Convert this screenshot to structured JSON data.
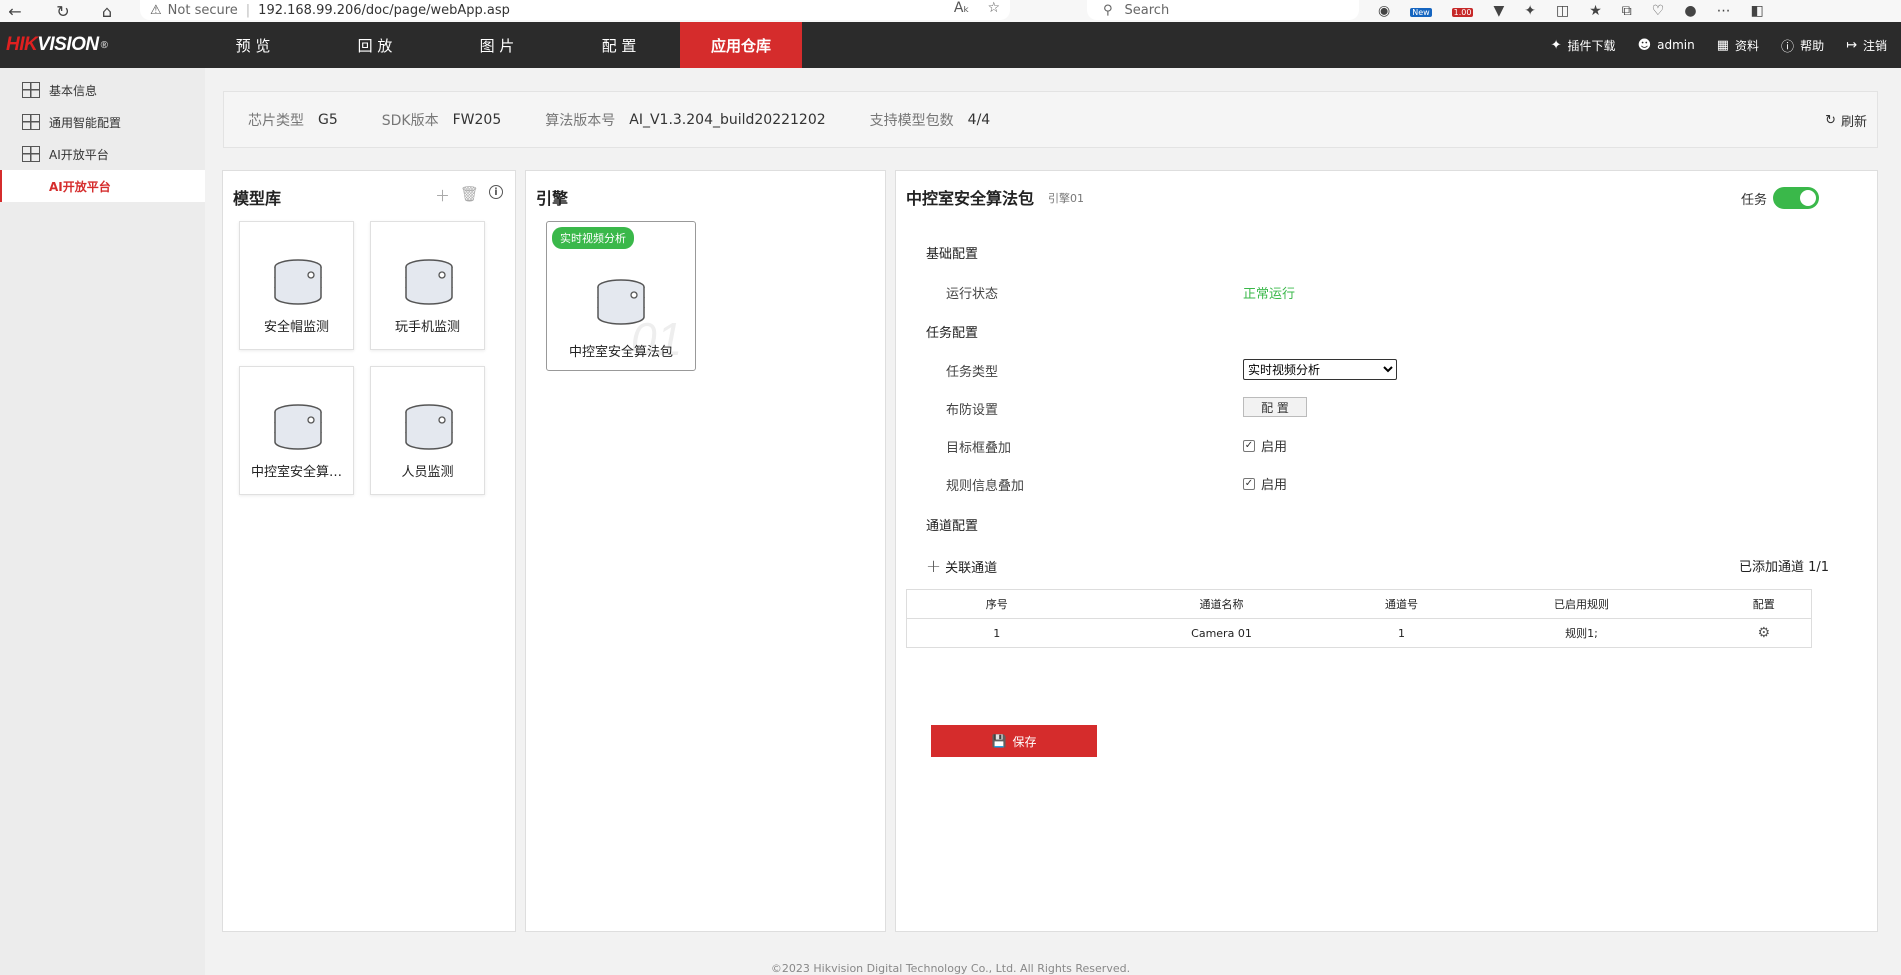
{
  "browser": {
    "security_label": "Not secure",
    "url": "192.168.99.206/doc/page/webApp.asp",
    "search_placeholder": "Search",
    "ext_badge_new": "New",
    "ext_badge_version": "1.00"
  },
  "header": {
    "logo_brand": "HIK",
    "logo_rest": "VISION",
    "logo_reg": "®",
    "menu": [
      {
        "label": "预 览"
      },
      {
        "label": "回 放"
      },
      {
        "label": "图 片"
      },
      {
        "label": "配 置"
      },
      {
        "label": "应用仓库"
      }
    ],
    "active_index": 4,
    "plugin_download": "插件下载",
    "user": "admin",
    "docs": "资料",
    "help": "帮助",
    "logout": "注销"
  },
  "sidebar": {
    "items": [
      {
        "label": "基本信息"
      },
      {
        "label": "通用智能配置"
      },
      {
        "label": "AI开放平台"
      }
    ],
    "active_label": "AI开放平台"
  },
  "info": {
    "chip_label": "芯片类型",
    "chip_value": "G5",
    "sdk_label": "SDK版本",
    "sdk_value": "FW205",
    "algo_label": "算法版本号",
    "algo_value": "AI_V1.3.204_build20221202",
    "model_label": "支持模型包数",
    "model_value": "4/4",
    "refresh": "刷新"
  },
  "model_lib": {
    "title": "模型库",
    "items": [
      {
        "name": "安全帽监测"
      },
      {
        "name": "玩手机监测"
      },
      {
        "name": "中控室安全算…"
      },
      {
        "name": "人员监测"
      }
    ]
  },
  "engine": {
    "title": "引擎",
    "card_tag": "实时视频分析",
    "card_watermark": "01",
    "card_name": "中控室安全算法包"
  },
  "detail": {
    "title": "中控室安全算法包",
    "subtitle": "引擎01",
    "task_label": "任务",
    "task_enabled": true,
    "basic_section": "基础配置",
    "run_status_label": "运行状态",
    "run_status_value": "正常运行",
    "task_section": "任务配置",
    "task_type_label": "任务类型",
    "task_type_value": "实时视频分析",
    "defense_label": "布防设置",
    "defense_button": "配 置",
    "target_box_label": "目标框叠加",
    "target_box_enabled": "启用",
    "rule_info_label": "规则信息叠加",
    "rule_info_enabled": "启用",
    "channel_section": "通道配置",
    "assoc_channel": "关联通道",
    "added_channels": "已添加通道 1/1",
    "table": {
      "headers": [
        "序号",
        "通道名称",
        "通道号",
        "已启用规则",
        "配置"
      ],
      "rows": [
        {
          "index": "1",
          "name": "Camera 01",
          "channel": "1",
          "rules": "规则1;"
        }
      ]
    },
    "save": "保存"
  },
  "footer": "©2023 Hikvision Digital Technology Co., Ltd. All Rights Reserved.",
  "colors": {
    "brand_red": "#d52c2c",
    "nav_bg": "#2b2b2b",
    "ok_green": "#3ab84a"
  }
}
